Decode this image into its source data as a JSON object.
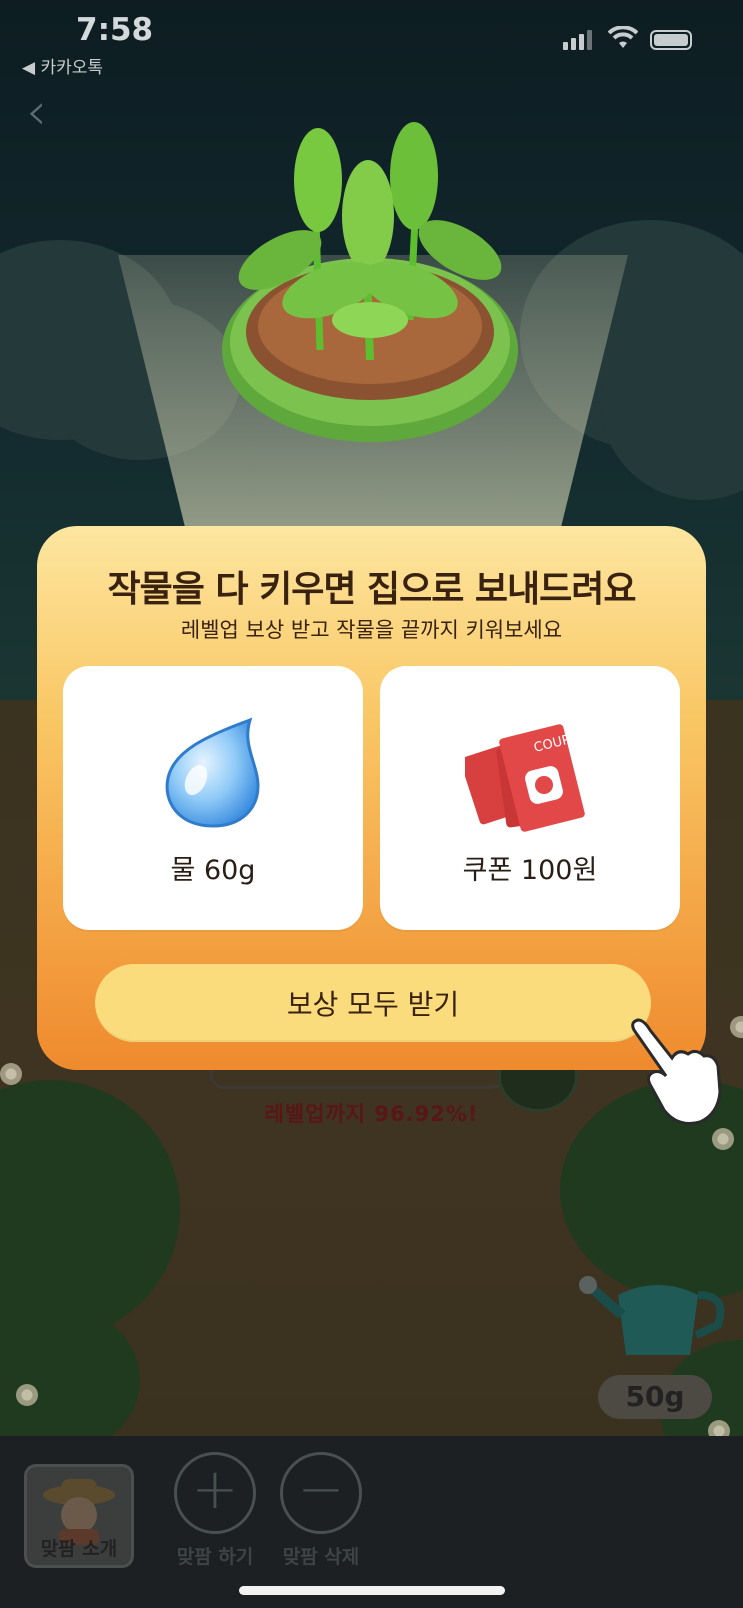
{
  "status_bar": {
    "time": "7:58",
    "back_app": "◀ 카카오톡"
  },
  "modal": {
    "title": "작물을 다 키우면 집으로 보내드려요",
    "subtitle": "레벨업 보상 받고 작물을 끝까지 키워보세요",
    "rewards": [
      {
        "label": "물 60g",
        "icon": "water-drop-icon"
      },
      {
        "label": "쿠폰 100원",
        "icon": "coupon-icon",
        "coupon_text": "COUPON"
      }
    ],
    "claim_button": "보상 모두 받기"
  },
  "game": {
    "level_progress_text": "레벨업까지 96.92%!",
    "level_progress_percent": 96.92,
    "water_amount": "50g"
  },
  "bottom_bar": {
    "intro_label": "맞팜 소개",
    "add_label": "맞팜 하기",
    "remove_label": "맞팜 삭제"
  },
  "colors": {
    "modal_top": "#fde6a0",
    "modal_bottom": "#ef8a2e",
    "claim_button": "#fbdc7d",
    "coupon_red": "#e04545",
    "water_blue": "#4a9fe8"
  }
}
